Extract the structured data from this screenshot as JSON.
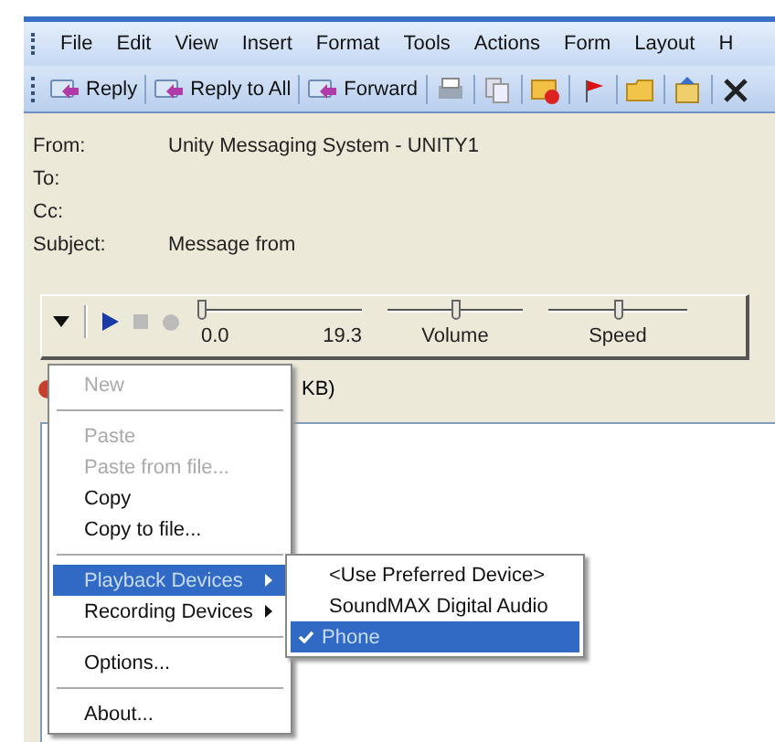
{
  "menu_bar": [
    "File",
    "Edit",
    "View",
    "Insert",
    "Format",
    "Tools",
    "Actions",
    "Form",
    "Layout",
    "H"
  ],
  "toolbar": [
    {
      "label": "Reply",
      "kind": "text"
    },
    {
      "label": "Reply to All",
      "kind": "text"
    },
    {
      "label": "Forward",
      "kind": "text"
    },
    {
      "kind": "print"
    },
    {
      "kind": "copy"
    },
    {
      "kind": "mail"
    },
    {
      "kind": "flag"
    },
    {
      "kind": "folder"
    },
    {
      "kind": "move"
    },
    {
      "kind": "delete"
    }
  ],
  "header": [
    {
      "label": "From:",
      "value": "Unity Messaging System - UNITY1"
    },
    {
      "label": "To:"
    },
    {
      "label": "Cc:"
    },
    {
      "label": "Subject:",
      "value": "Message from"
    }
  ],
  "player": {
    "position": {
      "level": 0,
      "reading": "0.0"
    },
    "length": "19.3",
    "volume": {
      "label": "Volume",
      "level": 0.5
    },
    "speed": {
      "label": "Speed",
      "level": 0.5
    },
    "play_enabled": true,
    "stop_enabled": false,
    "record_enabled": false
  },
  "attachment": {
    "text": "KB)"
  },
  "context_menu": [
    {
      "kind": "item",
      "label": "New",
      "disabled": true,
      "submenu": false,
      "selected": false
    },
    {
      "kind": "separator"
    },
    {
      "kind": "item",
      "label": "Paste",
      "disabled": true,
      "submenu": false,
      "selected": false
    },
    {
      "kind": "item",
      "label": "Paste from file...",
      "disabled": true,
      "submenu": false,
      "selected": false
    },
    {
      "kind": "item",
      "label": "Copy",
      "disabled": false,
      "submenu": false,
      "selected": false
    },
    {
      "kind": "item",
      "label": "Copy to file...",
      "disabled": false,
      "submenu": false,
      "selected": false
    },
    {
      "kind": "separator"
    },
    {
      "kind": "item",
      "label": "Playback Devices",
      "disabled": false,
      "submenu": true,
      "selected": true
    },
    {
      "kind": "item",
      "label": "Recording Devices",
      "disabled": false,
      "submenu": true,
      "selected": false
    },
    {
      "kind": "separator"
    },
    {
      "kind": "item",
      "label": "Options...",
      "disabled": false,
      "submenu": false,
      "selected": false
    },
    {
      "kind": "separator"
    },
    {
      "kind": "item",
      "label": "About...",
      "disabled": false,
      "submenu": false,
      "selected": false
    }
  ],
  "submenu": [
    {
      "label": "<Use Preferred Device>",
      "checked": false,
      "selected": false
    },
    {
      "label": "SoundMAX Digital Audio",
      "checked": false,
      "selected": false
    },
    {
      "label": "Phone",
      "checked": true,
      "selected": true
    }
  ]
}
